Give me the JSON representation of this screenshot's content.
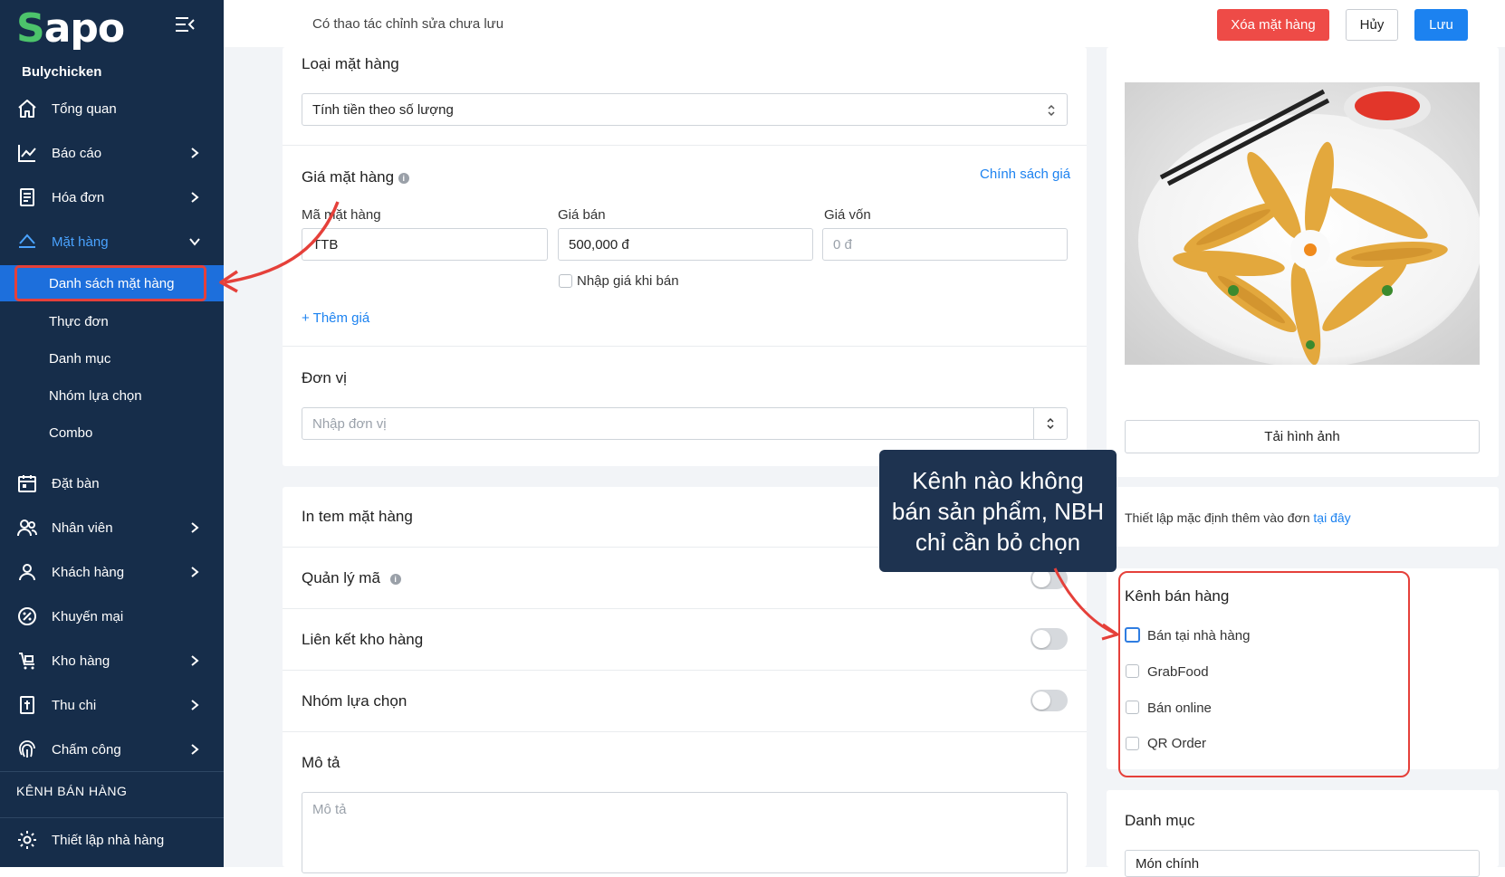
{
  "sidebar": {
    "logo_text": "Sapo",
    "store_name": "Bulychicken",
    "items": [
      {
        "label": "Tổng quan"
      },
      {
        "label": "Báo cáo"
      },
      {
        "label": "Hóa đơn"
      },
      {
        "label": "Mặt hàng"
      },
      {
        "label": "Đặt bàn"
      },
      {
        "label": "Nhân viên"
      },
      {
        "label": "Khách hàng"
      },
      {
        "label": "Khuyến mại"
      },
      {
        "label": "Kho hàng"
      },
      {
        "label": "Thu chi"
      },
      {
        "label": "Chấm công"
      }
    ],
    "sub_items": [
      {
        "label": "Danh sách mặt hàng"
      },
      {
        "label": "Thực đơn"
      },
      {
        "label": "Danh mục"
      },
      {
        "label": "Nhóm lựa chọn"
      },
      {
        "label": "Combo"
      }
    ],
    "section_title": "KÊNH BÁN HÀNG",
    "settings_label": "Thiết lập nhà hàng",
    "accent_color": "#4aa3ff",
    "selected_color": "#1d6fdc"
  },
  "topbar": {
    "unsaved_text": "Có thao tác chỉnh sửa chưa lưu",
    "delete_label": "Xóa mặt hàng",
    "cancel_label": "Hủy",
    "save_label": "Lưu"
  },
  "form": {
    "item_type_label": "Loại mặt hàng",
    "item_type_value": "Tính tiền theo số lượng",
    "price_section_label": "Giá mặt hàng",
    "price_policy_link": "Chính sách giá",
    "code_label": "Mã mặt hàng",
    "code_value": "TTB",
    "sell_price_label": "Giá bán",
    "sell_price_value": "500,000 đ",
    "cost_price_label": "Giá vốn",
    "cost_price_placeholder": "0 đ",
    "enter_price_on_sale_label": "Nhập giá khi bán",
    "add_price_link": "+ Thêm giá",
    "unit_label": "Đơn vị",
    "unit_placeholder": "Nhập đơn vị",
    "print_label": "In tem mặt hàng",
    "code_manage_label": "Quản lý mã",
    "warehouse_link_label": "Liên kết kho hàng",
    "option_group_label": "Nhóm lựa chọn",
    "description_label": "Mô tả",
    "description_placeholder": "Mô tả"
  },
  "right": {
    "upload_label": "Tải hình ảnh",
    "default_setting_text": "Thiết lập mặc định thêm vào đơn",
    "default_setting_link": "tại đây",
    "channels_title": "Kênh bán hàng",
    "channels": [
      {
        "label": "Bán tại nhà hàng"
      },
      {
        "label": "GrabFood"
      },
      {
        "label": "Bán online"
      },
      {
        "label": "QR Order"
      }
    ],
    "category_title": "Danh mục",
    "category_value": "Món chính"
  },
  "callout": {
    "line1": "Kênh nào không",
    "line2": "bán sản phẩm, NBH",
    "line3": "chỉ cần bỏ chọn"
  },
  "colors": {
    "sidebar_bg": "#162d4a",
    "delete_btn": "#ee4b47",
    "save_btn": "#1c82f0",
    "annotation_red": "#e5403a"
  }
}
